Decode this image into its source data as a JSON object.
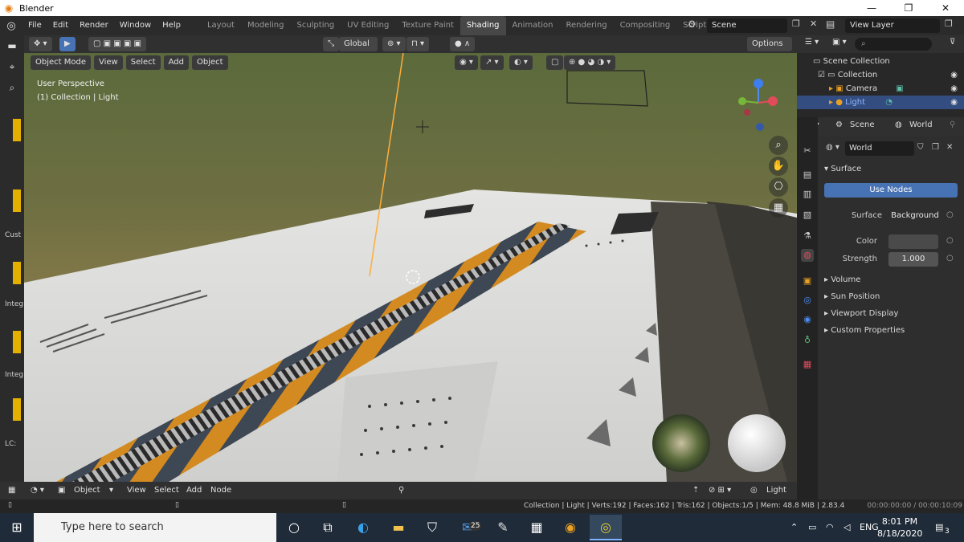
{
  "window": {
    "title": "Blender",
    "controls": [
      "—",
      "❐",
      "✕"
    ]
  },
  "menu": [
    "File",
    "Edit",
    "Render",
    "Window",
    "Help"
  ],
  "workspaces": [
    "Layout",
    "Modeling",
    "Sculpting",
    "UV Editing",
    "Texture Paint",
    "Shading",
    "Animation",
    "Rendering",
    "Compositing",
    "Scripting"
  ],
  "active_workspace": "Shading",
  "scene": {
    "label": "Scene"
  },
  "view_layer": {
    "label": "View Layer"
  },
  "viewport": {
    "mode": "Object Mode",
    "menus": [
      "View",
      "Select",
      "Add",
      "Object"
    ],
    "orientation": "Global",
    "options": "Options",
    "overlay_line1": "User Perspective",
    "overlay_line2": "(1) Collection | Light"
  },
  "left_strip_labels": [
    "Cust",
    "Integ",
    "Integ",
    "LC:"
  ],
  "node_editor": {
    "type": "Object",
    "menus": [
      "View",
      "Select",
      "Add",
      "Node"
    ],
    "active": "Light"
  },
  "status": {
    "stats": "Collection | Light | Verts:192 | Faces:162 | Tris:162 | Objects:1/5 | Mem: 48.8 MiB | 2.83.4",
    "time": "00:00:00:00 / 00:00:10:09"
  },
  "outliner": {
    "root": "Scene Collection",
    "items": [
      {
        "label": "Collection",
        "selected": false
      },
      {
        "label": "Camera",
        "selected": false
      },
      {
        "label": "Light",
        "selected": true
      }
    ]
  },
  "properties": {
    "header_scene": "Scene",
    "header_world": "World",
    "world_name": "World",
    "surface_panel": "Surface",
    "use_nodes": "Use Nodes",
    "surface_label": "Surface",
    "surface_value": "Background",
    "color_label": "Color",
    "strength_label": "Strength",
    "strength_value": "1.000",
    "collapsed_panels": [
      "Volume",
      "Sun Position",
      "Viewport Display",
      "Custom Properties"
    ]
  },
  "taskbar": {
    "search_placeholder": "Type here to search",
    "mail_badge": "25",
    "language": "ENG",
    "time": "8:01 PM",
    "date": "8/18/2020",
    "notifications": "3"
  },
  "colors": {
    "accent_orange": "#e8a025",
    "selection_blue": "#334d80",
    "use_nodes_blue": "#4772b3"
  }
}
